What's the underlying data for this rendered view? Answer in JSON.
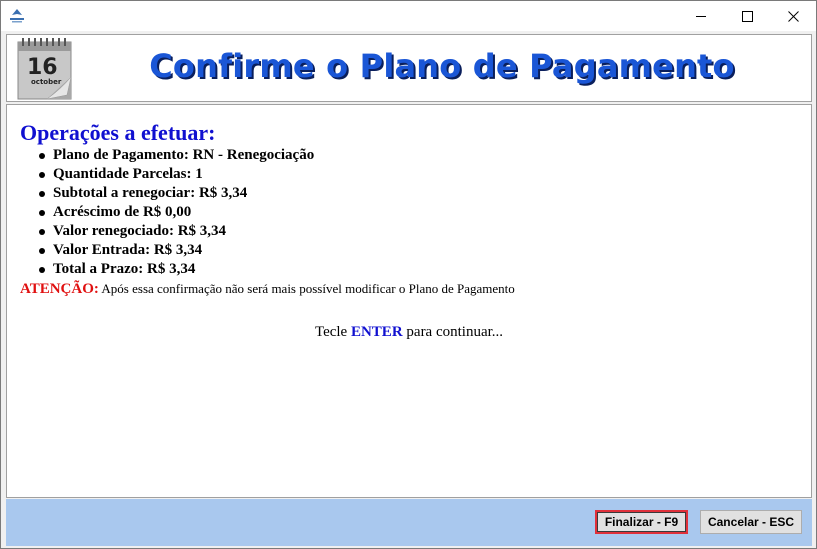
{
  "header": {
    "title": "Confirme o Plano de Pagamento",
    "calendar_day": "16",
    "calendar_month": "october"
  },
  "content": {
    "ops_title": "Operações a efetuar:",
    "items": [
      "Plano de Pagamento: RN - Renegociação",
      "Quantidade Parcelas: 1",
      "Subtotal a renegociar: R$ 3,34",
      "Acréscimo de R$ 0,00",
      "Valor renegociado: R$ 3,34",
      "Valor Entrada: R$ 3,34",
      "Total a Prazo: R$ 3,34"
    ],
    "warning_label": "ATENÇÃO:",
    "warning_text": " Após essa confirmação não será mais possível modificar o Plano de Pagamento",
    "continue_pre": "Tecle ",
    "continue_key": "ENTER",
    "continue_post": " para continuar..."
  },
  "footer": {
    "finalizar_label": "Finalizar - F9",
    "cancelar_label": "Cancelar - ESC"
  },
  "colors": {
    "title_blue": "#1a56d6",
    "heading_blue": "#1010d0",
    "warning_red": "#e01010",
    "footer_bg": "#a9c8ee"
  }
}
